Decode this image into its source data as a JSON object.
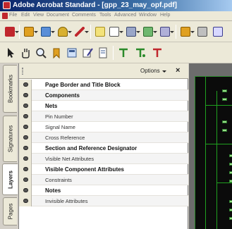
{
  "window": {
    "title": "Adobe Acrobat Standard - [gpp_23_may_opf.pdf]"
  },
  "menu": {
    "items": [
      "File",
      "Edit",
      "View",
      "Document",
      "Comments",
      "Tools",
      "Advanced",
      "Window",
      "Help"
    ]
  },
  "nav_tabs": [
    {
      "label": "Bookmarks",
      "active": false
    },
    {
      "label": "Signatures",
      "active": false
    },
    {
      "label": "Layers",
      "active": true
    },
    {
      "label": "Pages",
      "active": false
    }
  ],
  "layers_panel": {
    "options_label": "Options",
    "close_symbol": "×",
    "layers": [
      {
        "label": "Page Border and Title Block",
        "bold": true
      },
      {
        "label": "Components",
        "bold": true
      },
      {
        "label": "Nets",
        "bold": true
      },
      {
        "label": "Pin Number",
        "bold": false
      },
      {
        "label": "Signal Name",
        "bold": false
      },
      {
        "label": "Cross Reference",
        "bold": false
      },
      {
        "label": "Section and Reference Designator",
        "bold": true
      },
      {
        "label": "Visible Net Attributes",
        "bold": false
      },
      {
        "label": "Visible Component Attributes",
        "bold": true
      },
      {
        "label": "Constraints",
        "bold": false
      },
      {
        "label": "Notes",
        "bold": true
      },
      {
        "label": "Invisible Attributes",
        "bold": false
      }
    ]
  },
  "colors": {
    "titlebar": "#0a246a",
    "pcb_trace": "#1fa01f",
    "pdf_red": "#c0272d"
  }
}
